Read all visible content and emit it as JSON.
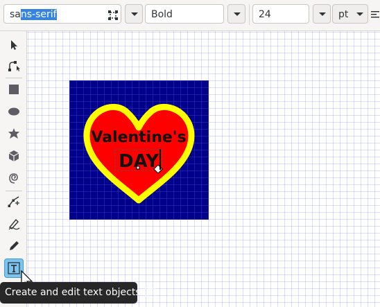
{
  "text_toolbar": {
    "font_family": {
      "value_prefix": "sa",
      "value_selected": "ns-serif"
    },
    "font_style": {
      "value": "Bold"
    },
    "font_size": {
      "value": "24"
    },
    "unit": {
      "value": "pt"
    }
  },
  "toolbox": {
    "tools": [
      {
        "name": "selector"
      },
      {
        "name": "node-editor"
      },
      {
        "name": "rectangle"
      },
      {
        "name": "ellipse"
      },
      {
        "name": "star-polygon"
      },
      {
        "name": "3d-box"
      },
      {
        "name": "spiral"
      },
      {
        "name": "bezier-pen"
      },
      {
        "name": "calligraphy"
      },
      {
        "name": "pencil"
      },
      {
        "name": "text",
        "active": true
      }
    ]
  },
  "canvas": {
    "text_line1": "Valentine's",
    "text_line2": "DAY"
  },
  "tooltip": {
    "text": "Create and edit text objects (T)"
  },
  "colors": {
    "background_square": "#00008b",
    "heart_outline": "#ffff00",
    "heart_fill": "#ff0000",
    "selection": "#3584e4",
    "grid": "#3f3fff"
  }
}
